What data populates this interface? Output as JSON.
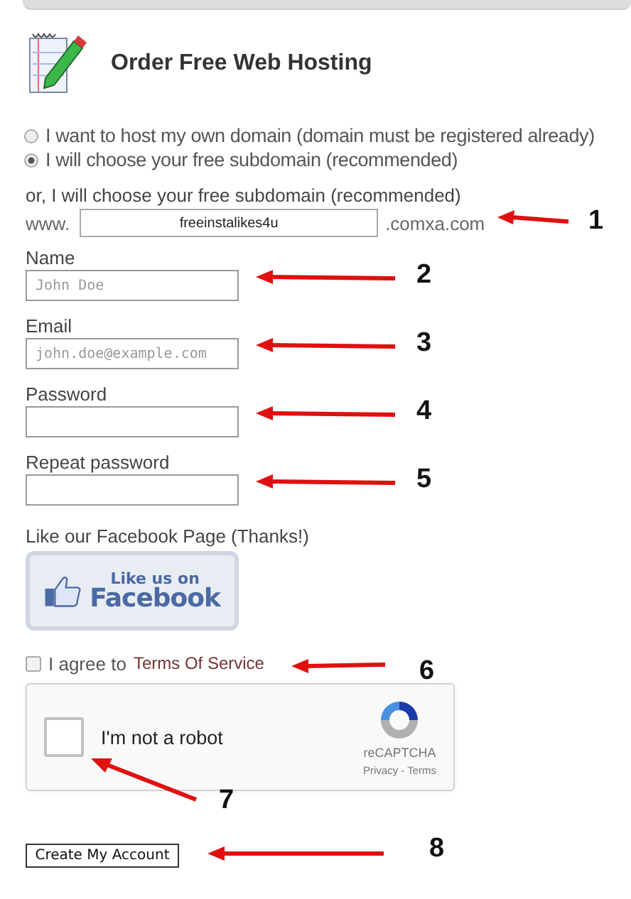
{
  "title": "Order Free Web Hosting",
  "hosting_options": [
    {
      "label": "I want to host my own domain (domain must be registered already)",
      "selected": false
    },
    {
      "label": "I will choose your free subdomain (recommended)",
      "selected": true
    }
  ],
  "subdomain": {
    "label": "or, I will choose your free subdomain (recommended)",
    "prefix": "www.",
    "value": "freeinstalikes4u",
    "suffix": ".comxa.com",
    "annotation": "1"
  },
  "fields": [
    {
      "label": "Name",
      "placeholder": "John Doe",
      "annotation": "2"
    },
    {
      "label": "Email",
      "placeholder": "john.doe@example.com",
      "annotation": "3"
    },
    {
      "label": "Password",
      "annotation": "4"
    },
    {
      "label": "Repeat password",
      "annotation": "5"
    }
  ],
  "facebook": {
    "label": "Like our Facebook Page (Thanks!)",
    "button_line1": "Like us on",
    "button_line2": "Facebook"
  },
  "terms": {
    "prefix": "I agree to",
    "link": "Terms Of Service",
    "checked": false,
    "annotation": "6"
  },
  "captcha": {
    "label": "I'm not a robot",
    "checked": false,
    "brand": "reCAPTCHA",
    "privacy": "Privacy",
    "separator": "-",
    "terms": "Terms",
    "annotation": "7"
  },
  "submit": {
    "label": "Create My Account",
    "annotation": "8"
  }
}
